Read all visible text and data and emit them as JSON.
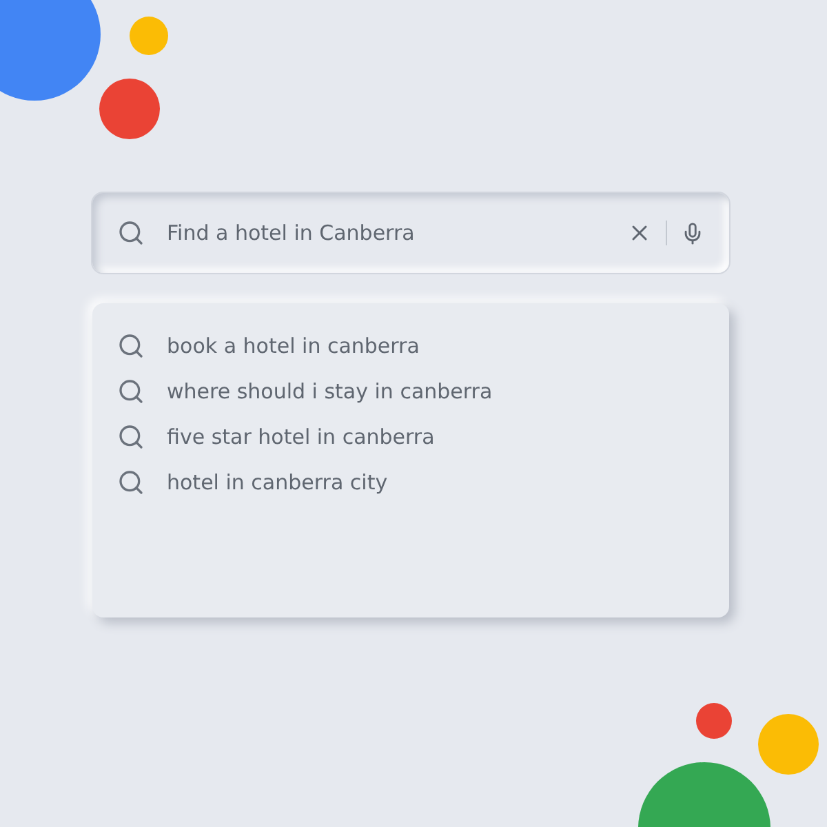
{
  "search": {
    "value": "Find a hotel in Canberra"
  },
  "suggestions": [
    {
      "text": "book a hotel in canberra"
    },
    {
      "text": "where should i stay in canberra"
    },
    {
      "text": "five star hotel in canberra"
    },
    {
      "text": "hotel in canberra city"
    }
  ]
}
